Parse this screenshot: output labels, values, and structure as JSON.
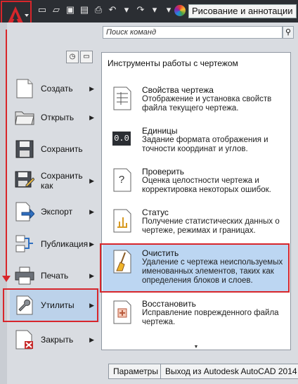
{
  "header": {
    "workspace": "Рисование и аннотации"
  },
  "search": {
    "placeholder": "Поиск команд"
  },
  "left_menu": {
    "items": [
      {
        "label": "Создать"
      },
      {
        "label": "Открыть"
      },
      {
        "label": "Сохранить"
      },
      {
        "label": "Сохранить как"
      },
      {
        "label": "Экспорт"
      },
      {
        "label": "Публикация"
      },
      {
        "label": "Печать"
      },
      {
        "label": "Утилиты"
      },
      {
        "label": "Закрыть"
      }
    ]
  },
  "panel": {
    "title": "Инструменты работы с чертежом",
    "items": [
      {
        "title": "Свойства чертежа",
        "desc": "Отображение и установка свойств файла текущего чертежа."
      },
      {
        "title": "Единицы",
        "desc": "Задание формата отображения и точности координат и углов.",
        "icon_text": "0.0"
      },
      {
        "title": "Проверить",
        "desc": "Оценка целостности чертежа и корректировка некоторых ошибок.",
        "icon_text": "?"
      },
      {
        "title": "Статус",
        "desc": "Получение статистических данных о чертеже, режимах и границах."
      },
      {
        "title": "Очистить",
        "desc": "Удаление с чертежа неиспользуемых именованных элементов, таких как определения блоков и слоев."
      },
      {
        "title": "Восстановить",
        "desc": "Исправление поврежденного файла чертежа."
      }
    ]
  },
  "bottom": {
    "options_label": "Параметры",
    "exit_label": "Выход из Autodesk AutoCAD 2014"
  },
  "colors": {
    "highlight": "#d8262b",
    "selection": "#bcd6f2"
  }
}
